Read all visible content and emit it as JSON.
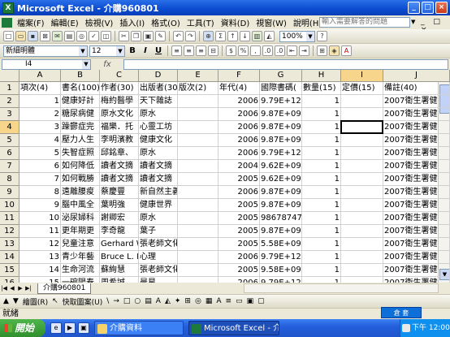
{
  "window": {
    "title": "Microsoft Excel - 介購960801",
    "minimize": "_",
    "maximize": "□",
    "close": "×"
  },
  "menu": {
    "items": [
      "檔案(F)",
      "編輯(E)",
      "檢視(V)",
      "插入(I)",
      "格式(O)",
      "工具(T)",
      "資料(D)",
      "視窗(W)",
      "說明(H)"
    ],
    "help_placeholder": "輸入需要解答的問題"
  },
  "toolbar": {
    "font_name": "新細明體",
    "font_size": "12",
    "zoom": "100%",
    "bold": "B",
    "italic": "I",
    "underline": "U"
  },
  "formula_bar": {
    "name_box": "I4",
    "fx": "fx",
    "value": ""
  },
  "grid": {
    "columns": [
      "A",
      "B",
      "C",
      "D",
      "E",
      "F",
      "G",
      "H",
      "I",
      "J"
    ],
    "selected_column": "I",
    "selected_row": "4",
    "rows": [
      {
        "n": "1",
        "cells": [
          "項次(4)",
          "書名(100)",
          "作者(30)",
          "出版者(30)",
          "版次(2)",
          "年代(4)",
          "國際書碼(",
          "數量(15)",
          "定價(15)",
          "備註(40)"
        ]
      },
      {
        "n": "2",
        "cells": [
          "1",
          "健康好計",
          "梅約醫學",
          "天下雜誌",
          "",
          "2006",
          "9.79E+12",
          "1",
          "",
          "2007衛生署健"
        ]
      },
      {
        "n": "3",
        "cells": [
          "2",
          "糖尿病健",
          "原水文化",
          "原水",
          "",
          "2006",
          "9.87E+09",
          "1",
          "",
          "2007衛生署健"
        ]
      },
      {
        "n": "4",
        "cells": [
          "3",
          "躁鬱症完",
          "福樂．托",
          "心靈工坊",
          "",
          "2006",
          "9.87E+09",
          "1",
          "",
          "2007衛生署健"
        ]
      },
      {
        "n": "5",
        "cells": [
          "4",
          "壓力人生",
          "李明濱教",
          "健康文化（吳氏總經銷",
          "",
          "2006",
          "9.87E+09",
          "1",
          "",
          "2007衛生署健"
        ]
      },
      {
        "n": "6",
        "cells": [
          "5",
          "失智症照",
          "邱銘章、",
          "原水",
          "",
          "2006",
          "9.79E+12",
          "1",
          "",
          "2007衛生署健"
        ]
      },
      {
        "n": "7",
        "cells": [
          "6",
          "如何降低",
          "讀者文摘",
          "讀者文摘",
          "",
          "2004",
          "9.62E+09",
          "1",
          "",
          "2007衛生署健"
        ]
      },
      {
        "n": "8",
        "cells": [
          "7",
          "如何戰勝",
          "讀者文摘",
          "讀者文摘",
          "",
          "2005",
          "9.62E+09",
          "1",
          "",
          "2007衛生署健"
        ]
      },
      {
        "n": "9",
        "cells": [
          "8",
          "遠離腰痠",
          "蔡慶豐",
          "新自然主義",
          "",
          "2006",
          "9.87E+09",
          "1",
          "",
          "2007衛生署健"
        ]
      },
      {
        "n": "10",
        "cells": [
          "9",
          "腦中風全",
          "葉明強",
          "健康世界",
          "",
          "2005",
          "9.87E+09",
          "1",
          "",
          "2007衛生署健"
        ]
      },
      {
        "n": "11",
        "cells": [
          "10",
          "泌尿婦科",
          "謝卿宏",
          "原水",
          "",
          "2005",
          "986787479",
          "1",
          "",
          "2007衛生署健"
        ]
      },
      {
        "n": "12",
        "cells": [
          "11",
          "更年期更",
          "李奇龍",
          "葉子",
          "",
          "2005",
          "9.87E+09",
          "1",
          "",
          "2007衛生署健"
        ]
      },
      {
        "n": "13",
        "cells": [
          "12",
          "兒童注意",
          "Gerhard W",
          "張老師文化",
          "",
          "2005",
          "5.58E+09",
          "1",
          "",
          "2007衛生署健"
        ]
      },
      {
        "n": "14",
        "cells": [
          "13",
          "青少年藝",
          "Bruce L. M",
          "心理",
          "",
          "2006",
          "9.79E+12",
          "1",
          "",
          "2007衛生署健"
        ]
      },
      {
        "n": "15",
        "cells": [
          "14",
          "生命河流",
          "蘇絢慧",
          "張老師文化",
          "",
          "2005",
          "9.58E+09",
          "1",
          "",
          "2007衛生署健"
        ]
      },
      {
        "n": "16",
        "cells": [
          "15",
          "一碗陽春",
          "周希誠",
          "晨星",
          "",
          "2006",
          "9.79E+12",
          "1",
          "",
          "2007衛生署健"
        ]
      }
    ]
  },
  "sheet_tab": "介購960801",
  "draw_toolbar": [
    "▲",
    "▼",
    "繪圖(R)",
    "↖",
    "快取圖案(U)",
    "\\",
    "→",
    "□",
    "○",
    "▤",
    "A",
    "◭",
    "✦",
    "⊞",
    "◎",
    "▦",
    "A",
    "≡",
    "▭",
    "▣",
    "▢"
  ],
  "status": "就緒",
  "taskbar": {
    "start": "開始",
    "tasks": [
      "介購資料",
      "Microsoft Excel - 介..."
    ],
    "language": "倉 套",
    "clock": "下午 12:00"
  }
}
